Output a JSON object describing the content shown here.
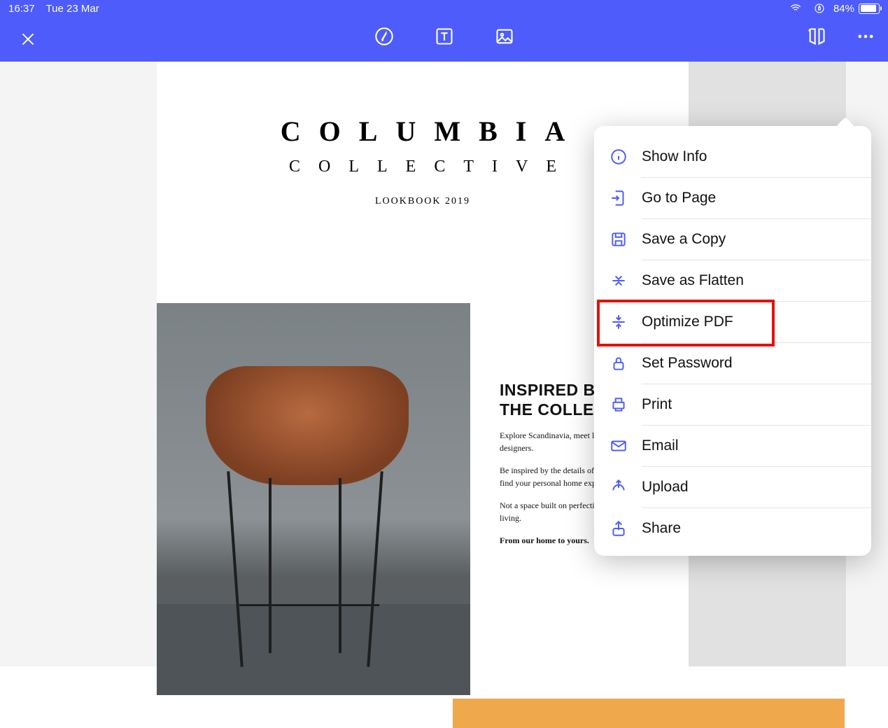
{
  "status": {
    "time": "16:37",
    "date": "Tue 23 Mar",
    "battery_pct": "84%"
  },
  "document": {
    "title_line1": "COLUMBIA",
    "title_line2": "COLLECTIVE",
    "subtitle": "LOOKBOOK 2019",
    "headline1": "INSPIRED BY",
    "headline2": "THE COLLECTIVE",
    "para1": "Explore Scandinavia, meet local and renowned designers.",
    "para2": "Be inspired by the details of design and passion to find your personal home expression.",
    "para3": "Not a space built on perfection, a home made for living.",
    "para4": "From our home to yours."
  },
  "menu": {
    "items": [
      {
        "label": "Show Info",
        "icon": "info-icon"
      },
      {
        "label": "Go to Page",
        "icon": "goto-page-icon"
      },
      {
        "label": "Save a Copy",
        "icon": "save-icon"
      },
      {
        "label": "Save as Flatten",
        "icon": "flatten-icon"
      },
      {
        "label": "Optimize PDF",
        "icon": "optimize-icon"
      },
      {
        "label": "Set Password",
        "icon": "lock-icon"
      },
      {
        "label": "Print",
        "icon": "print-icon"
      },
      {
        "label": "Email",
        "icon": "email-icon"
      },
      {
        "label": "Upload",
        "icon": "upload-icon"
      },
      {
        "label": "Share",
        "icon": "share-icon"
      }
    ],
    "highlighted_index": 4
  }
}
